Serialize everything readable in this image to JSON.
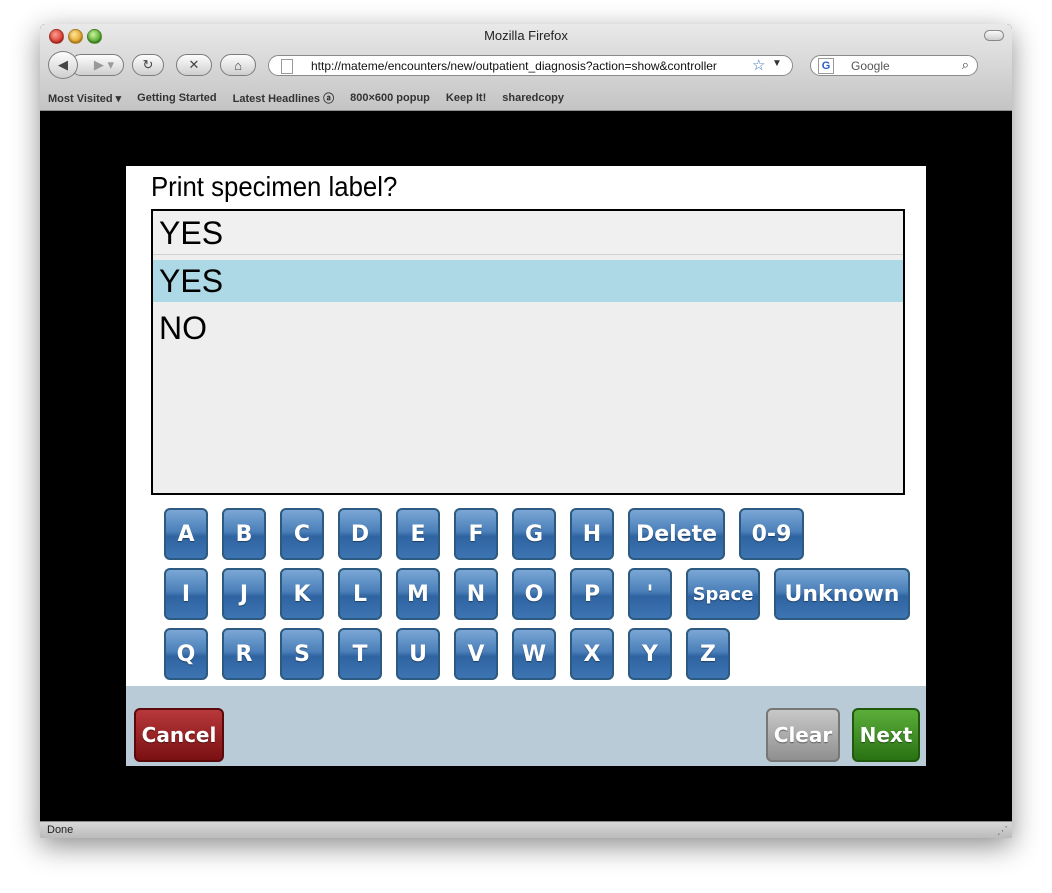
{
  "window": {
    "title": "Mozilla Firefox"
  },
  "nav": {
    "url": "http://mateme/encounters/new/outpatient_diagnosis?action=show&controller",
    "search_placeholder": "Google"
  },
  "bookmarks": [
    "Most Visited ▾",
    "Getting Started",
    "Latest Headlines ⓐ",
    "800×600 popup",
    "Keep It!",
    "sharedcopy"
  ],
  "status": {
    "text": "Done"
  },
  "form": {
    "question": "Print specimen label?",
    "input_value": "YES",
    "options": [
      {
        "label": "YES",
        "selected": true
      },
      {
        "label": "NO",
        "selected": false
      }
    ]
  },
  "keyboard": {
    "row1": [
      "A",
      "B",
      "C",
      "D",
      "E",
      "F",
      "G",
      "H",
      "Delete",
      "0-9"
    ],
    "row2": [
      "I",
      "J",
      "K",
      "L",
      "M",
      "N",
      "O",
      "P",
      "'",
      "Space",
      "Unknown"
    ],
    "row3": [
      "Q",
      "R",
      "S",
      "T",
      "U",
      "V",
      "W",
      "X",
      "Y",
      "Z"
    ]
  },
  "footer": {
    "cancel": "Cancel",
    "clear": "Clear",
    "next": "Next"
  },
  "colors": {
    "selected_option": "#add8e6",
    "key": "#3d74b2",
    "cancel": "#8b1a1c",
    "next": "#3a8a1f",
    "clear": "#a8a8a8",
    "footer_bg": "#b9cbd6"
  }
}
